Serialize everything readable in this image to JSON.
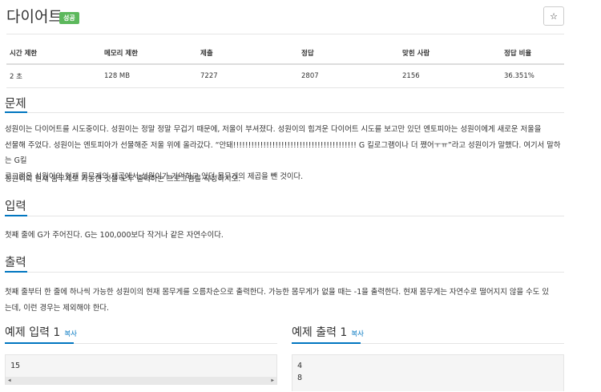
{
  "header": {
    "title": "다이어트",
    "badge": "성공",
    "star": "☆"
  },
  "info_table": {
    "headers": [
      "시간 제한",
      "메모리 제한",
      "제출",
      "정답",
      "맞힌 사람",
      "정답 비율"
    ],
    "values": [
      "2 초",
      "128 MB",
      "7227",
      "2807",
      "2156",
      "36.351%"
    ]
  },
  "problem": {
    "heading": "문제",
    "lines": [
      "성원이는 다이어트를 시도중이다. 성원이는 정말 정말 무겁기 때문에, 저울이 부셔졌다. 성원이의 힘겨운 다이어트 시도를 보고만 있던 엔토피아는 성원이에게 새로운 저울을",
      "선물해 주었다. 성원이는 엔토피아가 선물해준 저울 위에 올라갔다. “안돼!!!!!!!!!!!!!!!!!!!!!!!!!!!!!!!!!!!!!!!!! G 킬로그램이나 더 쪘어ㅜㅠ”라고 성원이가 말했다. 여기서 말하는 G킬",
      "로그램은 성원이의 현재 몸무게의 제곱에서 성원이가 기억하고 있던 몸무게의 제곱을 뺀 것이다.",
      "성원이의 현재 몸무게로 가능한 것을 모두 출력하는 프로그램을 작성하시오."
    ]
  },
  "input": {
    "heading": "입력",
    "text": "첫째 줄에 G가 주어진다. G는 100,000보다 작거나 같은 자연수이다."
  },
  "output": {
    "heading": "출력",
    "lines": [
      "첫째 줄부터 한 줄에 하나씩 가능한 성원이의 현재 몸무게를 오름차순으로 출력한다. 가능한 몸무게가 없을 때는 -1을 출력한다. 현재 몸무게는 자연수로 떨어지지 않을 수도 있",
      "는데, 이런 경우는 제외해야 한다."
    ]
  },
  "sample_input": {
    "title": "예제 입력 1",
    "copy": "복사",
    "lines": [
      "15"
    ]
  },
  "sample_output": {
    "title": "예제 출력 1",
    "copy": "복사",
    "lines": [
      "4",
      "8"
    ]
  },
  "scroll_arrows": {
    "left": "◀",
    "right": "▶"
  }
}
